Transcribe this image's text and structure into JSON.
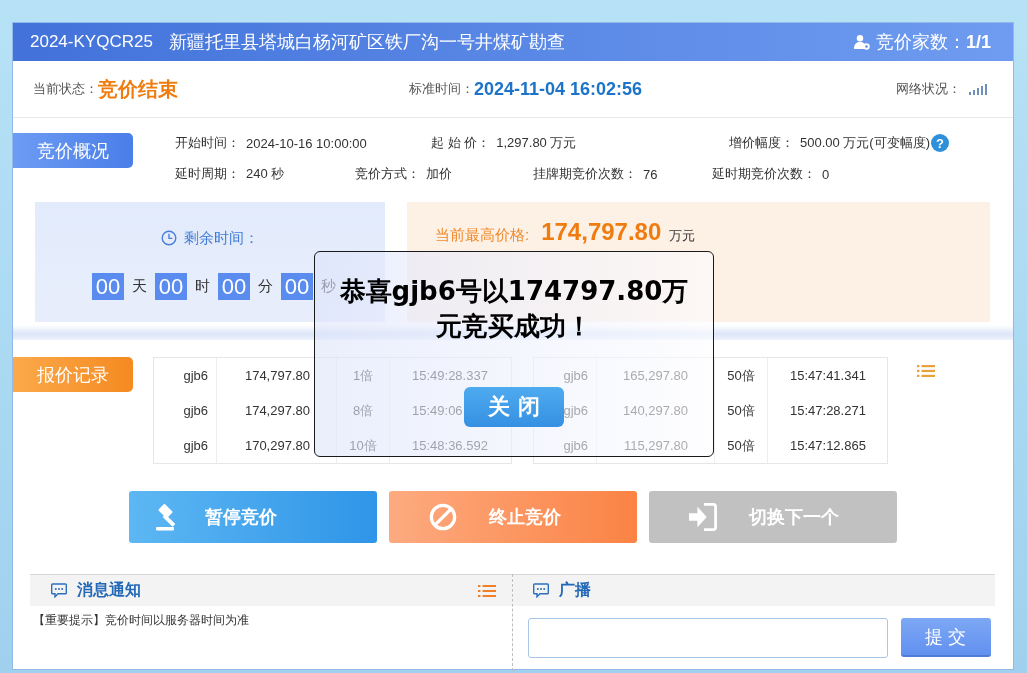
{
  "header": {
    "code": "2024-KYQCR25",
    "title": "新疆托里县塔城白杨河矿区铁厂沟一号井煤矿勘查",
    "bidders_label": "竞价家数：",
    "bidders": "1/1"
  },
  "status_bar": {
    "state_label": "当前状态：",
    "state": "竞价结束",
    "time_label": "标准时间：",
    "time": "2024-11-04 16:02:56",
    "network_label": "网络状况："
  },
  "overview": {
    "tab": "竞价概况",
    "field_rows": [
      [
        {
          "label": "开始时间：",
          "value": "2024-10-16 10:00:00"
        },
        {
          "label": "起 始 价：",
          "value": "1,297.80 万元"
        },
        {
          "label": "增价幅度：",
          "value": "500.00 万元(可变幅度)",
          "help": "?"
        }
      ],
      [
        {
          "label": "延时周期：",
          "value": "240 秒"
        },
        {
          "label": "竞价方式：",
          "value": "加价"
        },
        {
          "label": "挂牌期竞价次数：",
          "value": "76"
        },
        {
          "label": "延时期竞价次数：",
          "value": "0"
        }
      ]
    ],
    "countdown": {
      "label": "剩余时间：",
      "parts": [
        {
          "value": "00",
          "unit": "天"
        },
        {
          "value": "00",
          "unit": "时"
        },
        {
          "value": "00",
          "unit": "分"
        },
        {
          "value": "00",
          "unit": "秒"
        }
      ]
    },
    "highest": {
      "label": "当前最高价格:",
      "value": "174,797.80",
      "unit": "万元"
    }
  },
  "records": {
    "tab": "报价记录",
    "tables": [
      {
        "rows": [
          {
            "bidder": "gjb6",
            "price": "174,797.80",
            "multiple": "1倍",
            "time": "15:49:28.337"
          },
          {
            "bidder": "gjb6",
            "price": "174,297.80",
            "multiple": "8倍",
            "time": "15:49:06"
          },
          {
            "bidder": "gjb6",
            "price": "170,297.80",
            "multiple": "10倍",
            "time": "15:48:36.592"
          }
        ]
      },
      {
        "rows": [
          {
            "bidder": "gjb6",
            "price": "165,297.80",
            "multiple": "50倍",
            "time": "15:47:41.341"
          },
          {
            "bidder": "gjb6",
            "price": "140,297.80",
            "multiple": "50倍",
            "time": "15:47:28.271"
          },
          {
            "bidder": "gjb6",
            "price": "115,297.80",
            "multiple": "50倍",
            "time": "15:47:12.865"
          }
        ]
      }
    ]
  },
  "actions": [
    {
      "kind": "pause",
      "label": "暂停竞价"
    },
    {
      "kind": "stop",
      "label": "终止竞价"
    },
    {
      "kind": "next",
      "label": "切换下一个"
    }
  ],
  "notices": {
    "title": "消息通知",
    "messages": [
      "【重要提示】竞价时间以服务器时间为准"
    ]
  },
  "broadcast": {
    "title": "广播",
    "submit": "提 交"
  },
  "dialog": {
    "message": "恭喜gjb6号以174797.80万元竞买成功！",
    "close": "关 闭"
  }
}
